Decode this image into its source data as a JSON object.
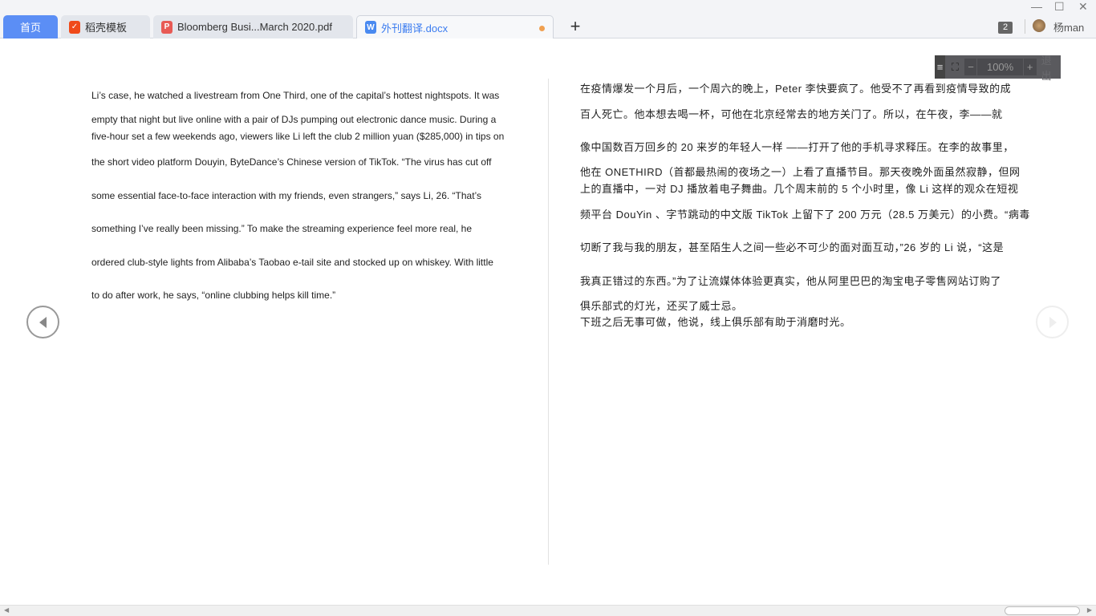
{
  "tabs": [
    {
      "label": "首页",
      "icon": "home"
    },
    {
      "label": "稻壳模板",
      "icon": "docer-icon"
    },
    {
      "label": "Bloomberg Busi...March 2020.pdf",
      "icon": "pdf-icon"
    },
    {
      "label": "外刊翻译.docx",
      "icon": "word-icon",
      "modified": true
    }
  ],
  "window": {
    "minimize": "—",
    "maximize": "☐",
    "close": "✕"
  },
  "header": {
    "window_count": "2",
    "username": "杨man"
  },
  "zoom_toolbar": {
    "menu": "≡",
    "fit": "⛶",
    "minus": "−",
    "value": "100%",
    "plus": "+",
    "exit": "退出"
  },
  "left_page": {
    "lines": [
      "Li’s case, he watched a livestream from One Third, one of the capital’s hottest nightspots. It was",
      "empty that night but live online with a pair of DJs pumping out electronic dance music. During a",
      "five-hour set a few weekends ago, viewers like Li left the club 2 million yuan ($285,000) in tips on",
      "the short video platform Douyin, ByteDance’s Chinese version of TikTok. “The virus has cut off",
      "some essential face-to-face interaction with my friends, even strangers,” says Li, 26. “That’s",
      "something I’ve really been missing.” To make the streaming experience feel more real, he",
      "ordered club-style lights from Alibaba’s Taobao e-tail site and stocked up on whiskey. With little",
      "to do after work, he says, “online clubbing helps kill time.”"
    ]
  },
  "right_page": {
    "lines": [
      "在疫情爆发一个月后，一个周六的晚上，Peter 李快要疯了。他受不了再看到疫情导致的成",
      "百人死亡。他本想去喝一杯，可他在北京经常去的地方关门了。所以，在午夜，李——就",
      "像中国数百万回乡的 20 来岁的年轻人一样 ——打开了他的手机寻求释压。在李的故事里，",
      "他在 ONETHIRD（首都最热闹的夜场之一）上看了直播节目。那天夜晚外面虽然寂静，但网",
      "上的直播中，一对 DJ 播放着电子舞曲。几个周末前的 5 个小时里，像 Li 这样的观众在短视",
      "频平台 DouYin 、字节跳动的中文版 TikTok 上留下了 200 万元（28.5 万美元）的小费。“病毒",
      "切断了我与我的朋友，甚至陌生人之间一些必不可少的面对面互动，”26 岁的 Li 说，“这是",
      "我真正错过的东西。”为了让流媒体体验更真实，他从阿里巴巴的淘宝电子零售网站订购了",
      "俱乐部式的灯光，还买了威士忌。",
      "下班之后无事可做，他说，线上俱乐部有助于消磨时光。"
    ]
  }
}
